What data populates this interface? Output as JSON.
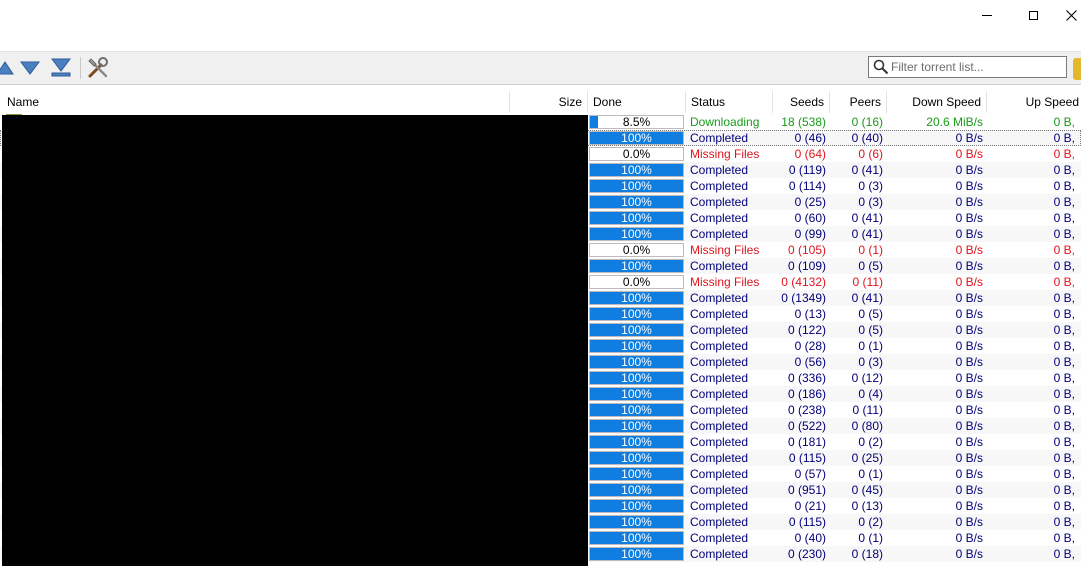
{
  "window": {
    "minimize": "–",
    "maximize": "□",
    "close": "✕"
  },
  "toolbar": {
    "buttons": [
      {
        "name": "move-up",
        "icon": "triangle-up-icon"
      },
      {
        "name": "move-down",
        "icon": "triangle-down-icon"
      },
      {
        "name": "move-bottom",
        "icon": "triangle-bottom-icon"
      },
      {
        "name": "options",
        "icon": "tools-icon"
      }
    ],
    "filter_placeholder": "Filter torrent list..."
  },
  "columns": {
    "name": "Name",
    "size": "Size",
    "done": "Done",
    "status": "Status",
    "seeds": "Seeds",
    "peers": "Peers",
    "down": "Down Speed",
    "up": "Up Speed"
  },
  "colors": {
    "downloading": "#1a9a1a",
    "completed": "#00007a",
    "missing": "#e0141e",
    "progress": "#0f7ee0"
  },
  "rows": [
    {
      "done": "8.5%",
      "progress": 0.085,
      "status": "Downloading",
      "kind": "downloading",
      "seeds": "18 (538)",
      "peers": "0 (16)",
      "down": "20.6 MiB/s",
      "up": "0 B,"
    },
    {
      "done": "100%",
      "progress": 1,
      "status": "Completed",
      "kind": "completed",
      "seeds": "0 (46)",
      "peers": "0 (40)",
      "down": "0 B/s",
      "up": "0 B,"
    },
    {
      "done": "0.0%",
      "progress": 0,
      "status": "Missing Files",
      "kind": "missing",
      "seeds": "0 (64)",
      "peers": "0 (6)",
      "down": "0 B/s",
      "up": "0 B,"
    },
    {
      "done": "100%",
      "progress": 1,
      "status": "Completed",
      "kind": "completed",
      "seeds": "0 (119)",
      "peers": "0 (41)",
      "down": "0 B/s",
      "up": "0 B,"
    },
    {
      "done": "100%",
      "progress": 1,
      "status": "Completed",
      "kind": "completed",
      "seeds": "0 (114)",
      "peers": "0 (3)",
      "down": "0 B/s",
      "up": "0 B,"
    },
    {
      "done": "100%",
      "progress": 1,
      "status": "Completed",
      "kind": "completed",
      "seeds": "0 (25)",
      "peers": "0 (3)",
      "down": "0 B/s",
      "up": "0 B,"
    },
    {
      "done": "100%",
      "progress": 1,
      "status": "Completed",
      "kind": "completed",
      "seeds": "0 (60)",
      "peers": "0 (41)",
      "down": "0 B/s",
      "up": "0 B,"
    },
    {
      "done": "100%",
      "progress": 1,
      "status": "Completed",
      "kind": "completed",
      "seeds": "0 (99)",
      "peers": "0 (41)",
      "down": "0 B/s",
      "up": "0 B,"
    },
    {
      "done": "0.0%",
      "progress": 0,
      "status": "Missing Files",
      "kind": "missing",
      "seeds": "0 (105)",
      "peers": "0 (1)",
      "down": "0 B/s",
      "up": "0 B,"
    },
    {
      "done": "100%",
      "progress": 1,
      "status": "Completed",
      "kind": "completed",
      "seeds": "0 (109)",
      "peers": "0 (5)",
      "down": "0 B/s",
      "up": "0 B,"
    },
    {
      "done": "0.0%",
      "progress": 0,
      "status": "Missing Files",
      "kind": "missing",
      "seeds": "0 (4132)",
      "peers": "0 (11)",
      "down": "0 B/s",
      "up": "0 B,"
    },
    {
      "done": "100%",
      "progress": 1,
      "status": "Completed",
      "kind": "completed",
      "seeds": "0 (1349)",
      "peers": "0 (41)",
      "down": "0 B/s",
      "up": "0 B,"
    },
    {
      "done": "100%",
      "progress": 1,
      "status": "Completed",
      "kind": "completed",
      "seeds": "0 (13)",
      "peers": "0 (5)",
      "down": "0 B/s",
      "up": "0 B,"
    },
    {
      "done": "100%",
      "progress": 1,
      "status": "Completed",
      "kind": "completed",
      "seeds": "0 (122)",
      "peers": "0 (5)",
      "down": "0 B/s",
      "up": "0 B,"
    },
    {
      "done": "100%",
      "progress": 1,
      "status": "Completed",
      "kind": "completed",
      "seeds": "0 (28)",
      "peers": "0 (1)",
      "down": "0 B/s",
      "up": "0 B,"
    },
    {
      "done": "100%",
      "progress": 1,
      "status": "Completed",
      "kind": "completed",
      "seeds": "0 (56)",
      "peers": "0 (3)",
      "down": "0 B/s",
      "up": "0 B,"
    },
    {
      "done": "100%",
      "progress": 1,
      "status": "Completed",
      "kind": "completed",
      "seeds": "0 (336)",
      "peers": "0 (12)",
      "down": "0 B/s",
      "up": "0 B,"
    },
    {
      "done": "100%",
      "progress": 1,
      "status": "Completed",
      "kind": "completed",
      "seeds": "0 (186)",
      "peers": "0 (4)",
      "down": "0 B/s",
      "up": "0 B,"
    },
    {
      "done": "100%",
      "progress": 1,
      "status": "Completed",
      "kind": "completed",
      "seeds": "0 (238)",
      "peers": "0 (11)",
      "down": "0 B/s",
      "up": "0 B,"
    },
    {
      "done": "100%",
      "progress": 1,
      "status": "Completed",
      "kind": "completed",
      "seeds": "0 (522)",
      "peers": "0 (80)",
      "down": "0 B/s",
      "up": "0 B,"
    },
    {
      "done": "100%",
      "progress": 1,
      "status": "Completed",
      "kind": "completed",
      "seeds": "0 (181)",
      "peers": "0 (2)",
      "down": "0 B/s",
      "up": "0 B,"
    },
    {
      "done": "100%",
      "progress": 1,
      "status": "Completed",
      "kind": "completed",
      "seeds": "0 (115)",
      "peers": "0 (25)",
      "down": "0 B/s",
      "up": "0 B,"
    },
    {
      "done": "100%",
      "progress": 1,
      "status": "Completed",
      "kind": "completed",
      "seeds": "0 (57)",
      "peers": "0 (1)",
      "down": "0 B/s",
      "up": "0 B,"
    },
    {
      "done": "100%",
      "progress": 1,
      "status": "Completed",
      "kind": "completed",
      "seeds": "0 (951)",
      "peers": "0 (45)",
      "down": "0 B/s",
      "up": "0 B,"
    },
    {
      "done": "100%",
      "progress": 1,
      "status": "Completed",
      "kind": "completed",
      "seeds": "0 (21)",
      "peers": "0 (13)",
      "down": "0 B/s",
      "up": "0 B,"
    },
    {
      "done": "100%",
      "progress": 1,
      "status": "Completed",
      "kind": "completed",
      "seeds": "0 (115)",
      "peers": "0 (2)",
      "down": "0 B/s",
      "up": "0 B,"
    },
    {
      "done": "100%",
      "progress": 1,
      "status": "Completed",
      "kind": "completed",
      "seeds": "0 (40)",
      "peers": "0 (1)",
      "down": "0 B/s",
      "up": "0 B,"
    },
    {
      "done": "100%",
      "progress": 1,
      "status": "Completed",
      "kind": "completed",
      "seeds": "0 (230)",
      "peers": "0 (18)",
      "down": "0 B/s",
      "up": "0 B,"
    }
  ]
}
